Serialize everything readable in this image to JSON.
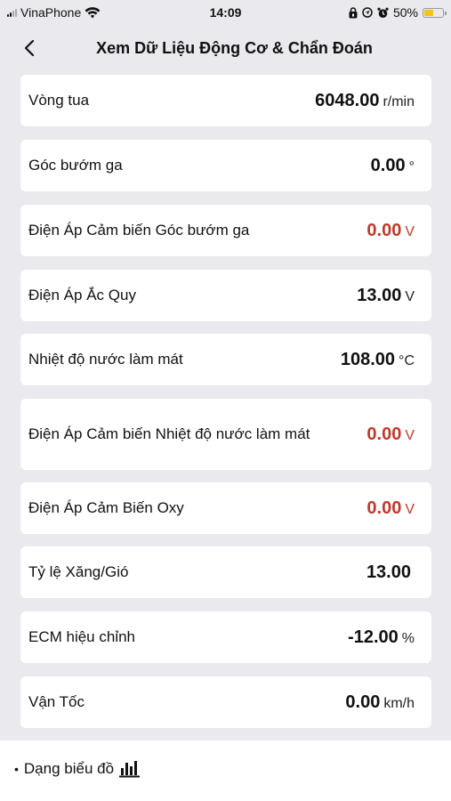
{
  "status_bar": {
    "carrier": "VinaPhone",
    "time": "14:09",
    "battery_percent": "50%",
    "battery_level": 0.5,
    "battery_color": "#f2c511",
    "icons": [
      "signal-icon",
      "wifi-icon",
      "lock-rotation-icon",
      "location-icon",
      "alarm-icon",
      "battery-icon"
    ]
  },
  "header": {
    "title": "Xem Dữ Liệu Động Cơ & Chẩn Đoán",
    "back_icon": "chevron-left-icon"
  },
  "colors": {
    "warning": "#c0392b",
    "background": "#e9e9ee",
    "card": "#ffffff"
  },
  "rows": [
    {
      "label": "Vòng tua",
      "value": "6048.00",
      "unit": "r/min",
      "warning": false
    },
    {
      "label": "Góc bướm ga",
      "value": "0.00",
      "unit": "°",
      "warning": false
    },
    {
      "label": "Điện Áp Cảm biến Góc bướm ga",
      "value": "0.00",
      "unit": "V",
      "warning": true
    },
    {
      "label": "Điện Áp Ắc Quy",
      "value": "13.00",
      "unit": "V",
      "warning": false
    },
    {
      "label": "Nhiệt độ nước làm mát",
      "value": "108.00",
      "unit": "°C",
      "warning": false
    },
    {
      "label": "Điện Áp Cảm biến Nhiệt độ nước làm mát",
      "value": "0.00",
      "unit": "V",
      "warning": true
    },
    {
      "label": "Điện Áp Cảm Biến Oxy",
      "value": "0.00",
      "unit": "V",
      "warning": true
    },
    {
      "label": "Tỷ lệ Xăng/Gió",
      "value": "13.00",
      "unit": "",
      "warning": false
    },
    {
      "label": "ECM hiệu chỉnh",
      "value": "-12.00",
      "unit": "%",
      "warning": false
    },
    {
      "label": "Vận Tốc",
      "value": "0.00",
      "unit": "km/h",
      "warning": false
    }
  ],
  "footer": {
    "bullet": "•",
    "chart_toggle_label": "Dạng biểu đồ",
    "chart_icon": "bar-chart-icon"
  }
}
